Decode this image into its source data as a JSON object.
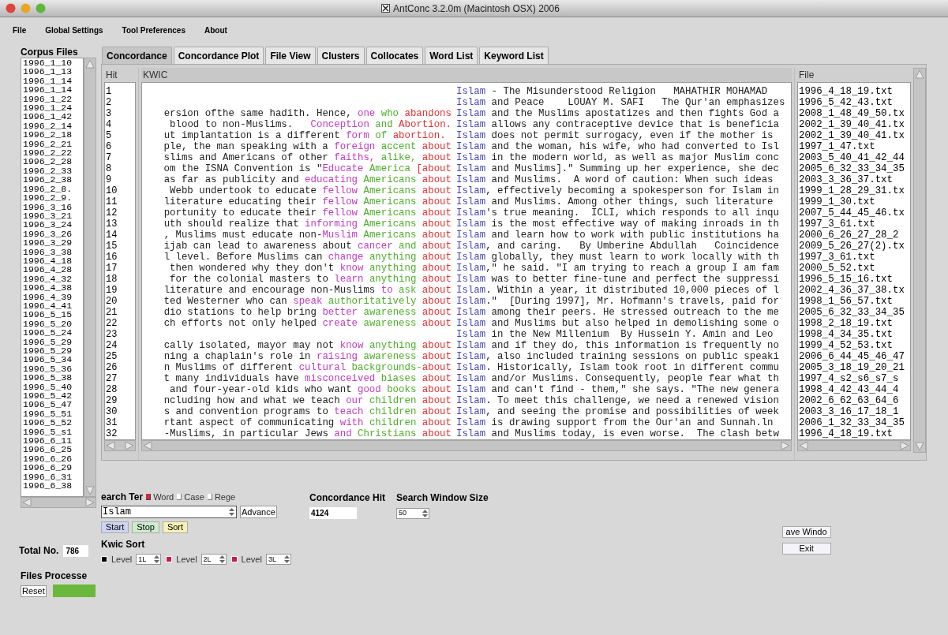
{
  "window": {
    "title": "AntConc 3.2.0m (Macintosh OSX) 2006"
  },
  "menu": [
    "File",
    "Global Settings",
    "Tool Preferences",
    "About"
  ],
  "corpus_files": {
    "label": "Corpus Files",
    "items": [
      "1996_1_10",
      "1996_1_13",
      "1996_1_14",
      "1996_1_14",
      "1996_1_22",
      "1996_1_24",
      "1996_1_42",
      "1996_2_14",
      "1996_2_18",
      "1996_2_21",
      "1996_2_22",
      "1996_2_28",
      "1996_2_33",
      "1996_2_38",
      "1996_2_8.",
      "1996_2_9.",
      "1996_3_16",
      "1996_3_21",
      "1996_3_24",
      "1996_3_26",
      "1996_3_29",
      "1996_3_38",
      "1996_4_18",
      "1996_4_28",
      "1996_4_32",
      "1996_4_38",
      "1996_4_39",
      "1996_4_41",
      "1996_5_15",
      "1996_5_20",
      "1996_5_24",
      "1996_5_29",
      "1996_5_29",
      "1996_5_34",
      "1996_5_36",
      "1996_5_38",
      "1996_5_40",
      "1996_5_42",
      "1996_5_47",
      "1996_5_51",
      "1996_5_52",
      "1996_5_s1",
      "1996_6_11",
      "1996_6_25",
      "1996_6_26",
      "1996_6_29",
      "1996_6_31",
      "1996_6_38"
    ]
  },
  "tabs": [
    {
      "label": "Concordance",
      "selected": true
    },
    {
      "label": "Concordance Plot",
      "selected": false
    },
    {
      "label": "File View",
      "selected": false
    },
    {
      "label": "Clusters",
      "selected": false
    },
    {
      "label": "Collocates",
      "selected": false
    },
    {
      "label": "Word List",
      "selected": false
    },
    {
      "label": "Keyword List",
      "selected": false
    }
  ],
  "concordance": {
    "columns": {
      "hit": "Hit",
      "kwic": "KWIC",
      "file": "File"
    },
    "rows": [
      {
        "hit": "1",
        "key": "Islam",
        "right": " - The Misunderstood Religion   MAHATHIR MOHAMAD",
        "file": "1996_4_18_19.txt"
      },
      {
        "hit": "2",
        "key": "Islam",
        "right": " and Peace    LOUAY M. SAFI   The Qur'an emphasizes",
        "file": "1996_5_42_43.txt"
      },
      {
        "hit": "3",
        "left": "ersion ofthe same hadith. Hence, ",
        "l3": "one ",
        "l2": "who ",
        "l1": "abandons",
        "key": "Islam",
        "right": " and the Muslims apostatizes and then fights God a",
        "file": "2008_1_48_49_50.tx"
      },
      {
        "hit": "4",
        "left": " blood to non-Muslims.   ",
        "l3": "Conception ",
        "l2": "and ",
        "l1": "Abortion.",
        "key": "Islam",
        "right": " allows any contraceptive device that is beneficia",
        "file": "2002_1_39_40_41.tx"
      },
      {
        "hit": "5",
        "left": "ut implantation is a different ",
        "l3": "form ",
        "l2": "of ",
        "l1": "abortion. ",
        "key": "Islam",
        "right": " does not permit surrogacy, even if the mother is",
        "file": "2002_1_39_40_41.tx"
      },
      {
        "hit": "6",
        "left": "ple, the man speaking with a ",
        "l3": "foreign ",
        "l2": "accent ",
        "l1": "about",
        "key": "Islam",
        "right": " and the woman, his wife, who had converted to Isl",
        "file": "1997_1_47.txt"
      },
      {
        "hit": "7",
        "left": "slims and Americans of other ",
        "l3": "faiths, ",
        "l2": "alike, ",
        "l1": "about",
        "key": "Islam",
        "right": " in the modern world, as well as major Muslim conc",
        "file": "2003_5_40_41_42_44"
      },
      {
        "hit": "8",
        "left": "om the ISNA Convention is \"",
        "l3": "Educate ",
        "l2": "America ",
        "l1": "[about",
        "key": "Islam",
        "right": " and Muslims].\" Summing up her experience, she dec",
        "file": "2005_6_32_33_34_35"
      },
      {
        "hit": "9",
        "left": "as far as publicity and ",
        "l3": "educating ",
        "l2": "Americans ",
        "l1": "about",
        "key": "Islam",
        "right": " and Muslims.  A word of caution: When such ideas",
        "file": "2003_3_36_37.txt"
      },
      {
        "hit": "10",
        "left": " Webb undertook to educate ",
        "l3": "fellow ",
        "l2": "Americans ",
        "l1": "about",
        "key": "Islam",
        "right": ", effectively becoming a spokesperson for Islam in",
        "file": "1999_1_28_29_31.tx"
      },
      {
        "hit": "11",
        "left": "literature educating their ",
        "l3": "fellow ",
        "l2": "Americans ",
        "l1": "about",
        "key": "Islam",
        "right": " and Muslims. Among other things, such literature",
        "file": "1999_1_30.txt"
      },
      {
        "hit": "12",
        "left": "portunity to educate their ",
        "l3": "fellow ",
        "l2": "Americans ",
        "l1": "about",
        "key": "Islam",
        "right": "'s true meaning.  ICLI, which responds to all inqu",
        "file": "2007_5_44_45_46.tx"
      },
      {
        "hit": "13",
        "left": "uth should realize that ",
        "l3": "informing ",
        "l2": "Americans ",
        "l1": "about",
        "key": "Islam",
        "right": " is the most effective way of making inroads in th",
        "file": "1997_3_61.txt"
      },
      {
        "hit": "14",
        "left": ", Muslims must educate non-",
        "l3": "Muslim ",
        "l2": "Americans ",
        "l1": "about",
        "key": "Islam",
        "right": " and learn how to work with public institutions ha",
        "file": "2000_6_26_27_28_2"
      },
      {
        "hit": "15",
        "left": "ijab can lead to awareness about ",
        "l3": "cancer ",
        "l2": "and ",
        "l1": "about",
        "key": "Islam",
        "right": ", and caring.   By Umberine Abdullah   Coincidence",
        "file": "2009_5_26_27(2).tx"
      },
      {
        "hit": "16",
        "left": "l level. Before Muslims can ",
        "l3": "change ",
        "l2": "anything ",
        "l1": "about",
        "key": "Islam",
        "right": " globally, they must learn to work locally with th",
        "file": "1997_3_61.txt"
      },
      {
        "hit": "17",
        "left": " then wondered why they don't ",
        "l3": "know ",
        "l2": "anything ",
        "l1": "about",
        "key": "Islam",
        "right": ",\" he said. \"I am trying to reach a group I am fam",
        "file": "2000_5_52.txt"
      },
      {
        "hit": "18",
        "left": " for the colonial masters to ",
        "l3": "learn ",
        "l2": "anything ",
        "l1": "about",
        "key": "Islam",
        "right": " was to better fine-tune and perfect the suppressi",
        "file": "1996_5_15_16.txt"
      },
      {
        "hit": "19",
        "left": "literature and encourage non-Muslims ",
        "l3": "to ",
        "l2": "ask ",
        "l1": "about",
        "key": "Islam",
        "right": ". Within a year, it distributed 10,000 pieces of l",
        "file": "2002_4_36_37_38.tx"
      },
      {
        "hit": "20",
        "left": "ted Westerner who can ",
        "l3": "speak ",
        "l2": "authoritatively ",
        "l1": "about",
        "key": "Islam",
        "right": ".\"  [During 1997], Mr. Hofmann's travels, paid for",
        "file": "1998_1_56_57.txt"
      },
      {
        "hit": "21",
        "left": "dio stations to help bring ",
        "l3": "better ",
        "l2": "awareness ",
        "l1": "about",
        "key": "Islam",
        "right": " among their peers. He stressed outreach to the me",
        "file": "2005_6_32_33_34_35"
      },
      {
        "hit": "22",
        "left": "ch efforts not only helped ",
        "l3": "create ",
        "l2": "awareness ",
        "l1": "about",
        "key": "Islam",
        "right": " and Muslims but also helped in demolishing some o",
        "file": "1998_2_18_19.txt"
      },
      {
        "hit": "23",
        "key": "Islam",
        "right": " in the New Millenium  By Hussein Y. Amin and Leo",
        "file": "1998_4_34_35.txt"
      },
      {
        "hit": "24",
        "left": "cally isolated, mayor may not ",
        "l3": "know ",
        "l2": "anything ",
        "l1": "about",
        "key": "Islam",
        "right": " and if they do, this information is frequently no",
        "file": "1999_4_52_53.txt"
      },
      {
        "hit": "25",
        "left": "ning a chaplain's role in ",
        "l3": "raising ",
        "l2": "awareness ",
        "l1": "about",
        "key": "Islam",
        "right": ", also included training sessions on public speaki",
        "file": "2006_6_44_45_46_47"
      },
      {
        "hit": "26",
        "left": "n Muslims of different ",
        "l3": "cultural ",
        "l2": "backgrounds-",
        "l1": "about",
        "key": "Islam",
        "right": ". Historically, Islam took root in different commu",
        "file": "2005_3_18_19_20_21"
      },
      {
        "hit": "27",
        "left": "t many individuals have ",
        "l3": "misconceived ",
        "l2": "biases ",
        "l1": "about",
        "key": "Islam",
        "right": " and/or Muslims. Consequently, people fear what th",
        "file": "1997_4_s2_s6_s7_s"
      },
      {
        "hit": "28",
        "left": " and four-year-old kids who want ",
        "l3": "good ",
        "l2": "books ",
        "l1": "about",
        "key": "Islam",
        "right": " and can't find - them,\" she says. \"The new genera",
        "file": "1998_4_42_43_44_4"
      },
      {
        "hit": "29",
        "left": "ncluding how and what we teach ",
        "l3": "our ",
        "l2": "children ",
        "l1": "about",
        "key": "Islam",
        "right": ". To meet this challenge, we need a renewed vision",
        "file": "2002_6_62_63_64_6"
      },
      {
        "hit": "30",
        "left": "s and convention programs to ",
        "l3": "teach ",
        "l2": "children ",
        "l1": "about",
        "key": "Islam",
        "right": ", and seeing the promise and possibilities of week",
        "file": "2003_3_16_17_18_1"
      },
      {
        "hit": "31",
        "left": "rtant aspect of communicating ",
        "l3": "with ",
        "l2": "children ",
        "l1": "about",
        "key": "Islam",
        "right": " is drawing support from the Our'an and Sunnah.ln",
        "file": "2006_1_32_33_34_35"
      },
      {
        "hit": "32",
        "left": "-Muslims, in particular Jews ",
        "l3": "and ",
        "l2": "Christians ",
        "l1": "about",
        "key": "Islam",
        "right": " and Muslims today, is even worse.  The clash betw",
        "file": "1996_4_18_19.txt"
      }
    ]
  },
  "search": {
    "label": "earch Ter",
    "options": [
      {
        "label": "Word",
        "checked": true
      },
      {
        "label": "Case",
        "checked": false
      },
      {
        "label": "Rege",
        "checked": false
      }
    ],
    "value": "Islam",
    "advanced_button": "Advance",
    "buttons": [
      {
        "label": "Start",
        "kind": "start"
      },
      {
        "label": "Stop",
        "kind": "stop"
      },
      {
        "label": "Sort",
        "kind": "sort"
      }
    ]
  },
  "concordance_hits": {
    "label": "Concordance Hit",
    "value": "4124"
  },
  "search_window_size": {
    "label": "Search Window Size",
    "value": "50"
  },
  "kwic_sort": {
    "label": "Kwic Sort",
    "levels": [
      {
        "label": "Level",
        "checked": true,
        "color": "#000000",
        "value": "1L"
      },
      {
        "label": "Level",
        "checked": true,
        "color": "#c0204a",
        "value": "2L"
      },
      {
        "label": "Level",
        "checked": true,
        "color": "#c0204a",
        "value": "3L"
      }
    ]
  },
  "total": {
    "label": "Total No.",
    "value": "786"
  },
  "files_processed": {
    "label": "Files Processe",
    "reset_button": "Reset",
    "level": 1
  },
  "window_buttons": [
    "ave Windo",
    "Exit"
  ]
}
